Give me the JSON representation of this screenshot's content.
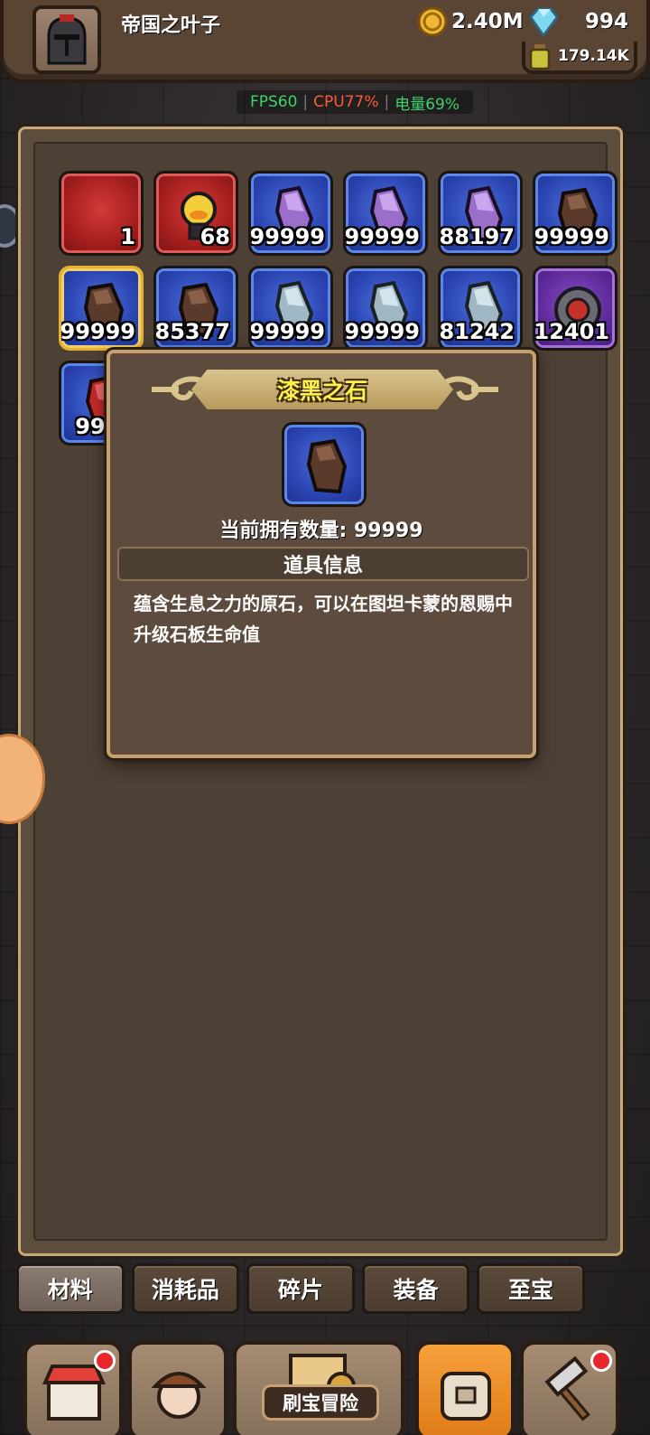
{
  "player": {
    "name": "帝国之叶子"
  },
  "resources": {
    "gold": "2.40M",
    "gems": "994",
    "potion": "179.14K"
  },
  "perf": {
    "fps": "FPS60",
    "cpu": "CPU77%",
    "battery": "电量69%"
  },
  "inventory": {
    "items": [
      {
        "count": "1",
        "frame": "red",
        "icon": "red-card-icon"
      },
      {
        "count": "68",
        "frame": "red",
        "icon": "hero-figure-icon"
      },
      {
        "count": "99999",
        "frame": "blue",
        "icon": "purple-stone-icon"
      },
      {
        "count": "99999",
        "frame": "blue",
        "icon": "purple-stone-icon"
      },
      {
        "count": "88197",
        "frame": "blue",
        "icon": "purple-stone-icon"
      },
      {
        "count": "99999",
        "frame": "blue",
        "icon": "dark-stone-icon"
      },
      {
        "count": "99999",
        "frame": "blue",
        "icon": "dark-stone-icon",
        "selected": true
      },
      {
        "count": "85377",
        "frame": "blue",
        "icon": "dark-stone-icon"
      },
      {
        "count": "99999",
        "frame": "blue",
        "icon": "gray-stone-icon"
      },
      {
        "count": "99999",
        "frame": "blue",
        "icon": "gray-stone-icon"
      },
      {
        "count": "81242",
        "frame": "blue",
        "icon": "gray-stone-icon"
      },
      {
        "count": "12401",
        "frame": "purple",
        "icon": "armor-chest-icon"
      },
      {
        "count": "9999",
        "frame": "blue",
        "icon": "red-stone-icon"
      }
    ]
  },
  "popup": {
    "title": "漆黑之石",
    "owned_label": "当前拥有数量:",
    "owned_value": "99999",
    "info_header": "道具信息",
    "description": "蕴含生息之力的原石，可以在图坦卡蒙的恩赐中升级石板生命值"
  },
  "tabs": [
    "材料",
    "消耗品",
    "碎片",
    "装备",
    "至宝"
  ],
  "active_tab": 0,
  "bottom_nav": {
    "center_label": "刷宝冒险"
  },
  "colors": {
    "gold_text": "#fff04a",
    "accent_orange": "#f7a03c",
    "perf_green": "#3fd16b",
    "perf_red": "#ff5a3c"
  }
}
